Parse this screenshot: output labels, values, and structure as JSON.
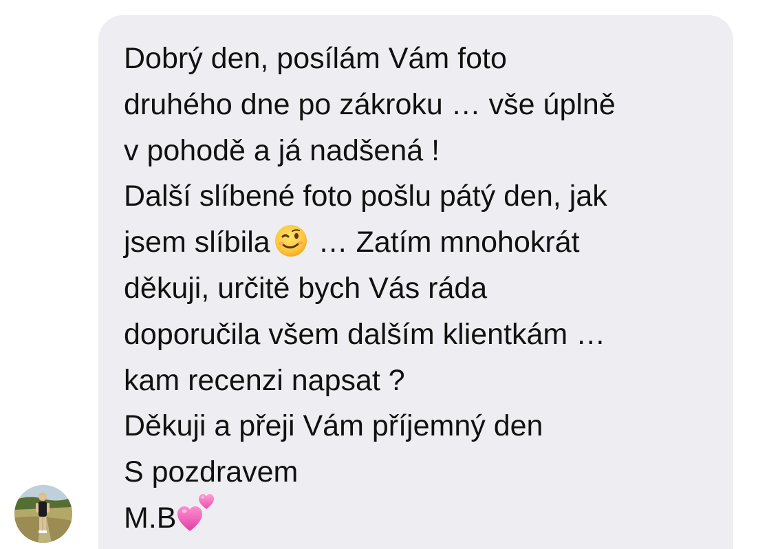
{
  "conversation": {
    "message": {
      "lines": [
        "Dobrý den, posílám Vám foto",
        "druhého dne po zákroku … vše úplně",
        "v pohodě a já nadšená !",
        "Další slíbené foto pošlu pátý den, jak",
        "jsem slíbila",
        " … Zatím mnohokrát",
        "děkuji, určitě bych Vás ráda",
        "doporučila všem dalším klientkám …",
        "kam recenzi napsat ?",
        "Děkuji a přeji Vám příjemný den",
        "S pozdravem",
        "M.B"
      ],
      "emoji": [
        "winking-face",
        "two-hearts"
      ]
    },
    "sender": {
      "avatar_icon": "profile-photo"
    }
  },
  "colors": {
    "bubble_background": "#eeeef2",
    "text": "#111111"
  }
}
